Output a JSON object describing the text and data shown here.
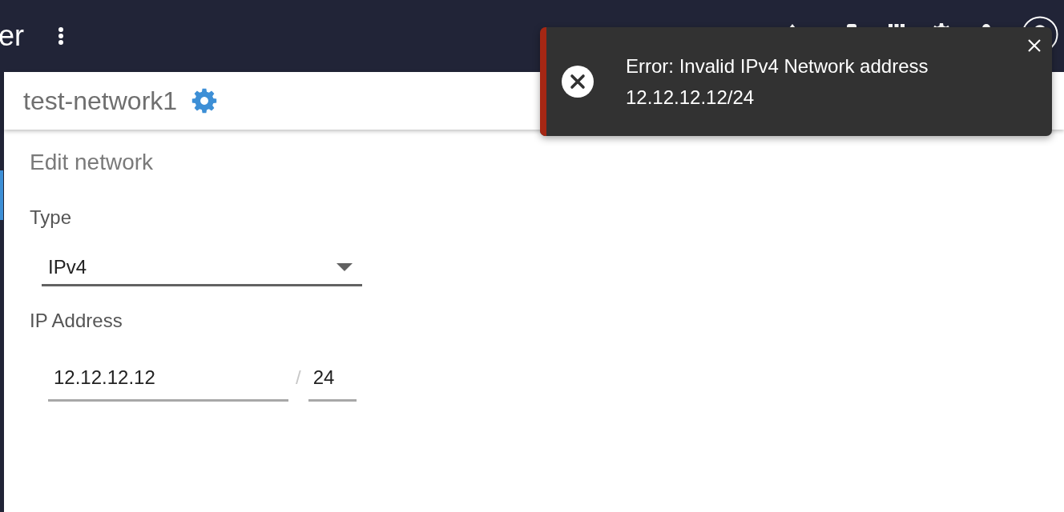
{
  "app_bar": {
    "title": "er"
  },
  "page": {
    "title": "test-network1",
    "section_title": "Edit network",
    "type_field": {
      "label": "Type",
      "value": "IPv4"
    },
    "ip_address": {
      "label": "IP Address",
      "address": "12.12.12.12",
      "separator": "/",
      "prefix": "24"
    }
  },
  "toast": {
    "kind": "error",
    "message": "Error: Invalid IPv4 Network address 12.12.12.12/24"
  }
}
